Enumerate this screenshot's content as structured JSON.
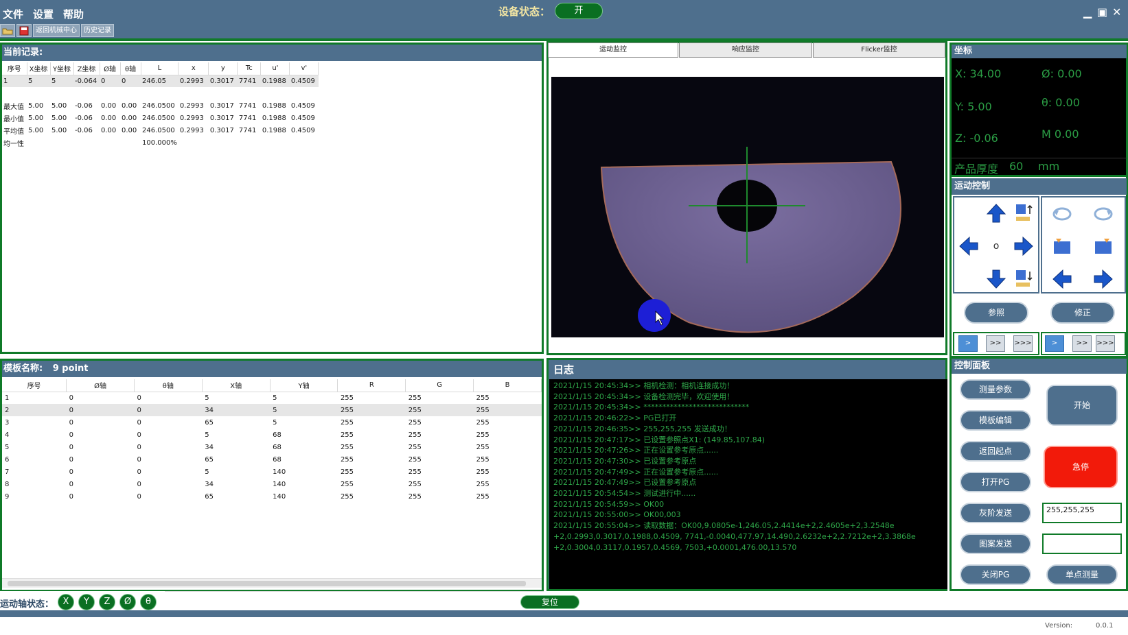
{
  "menu": [
    "文件",
    "设置",
    "帮助"
  ],
  "toolbar": {
    "return_center": "返回机械中心",
    "history": "历史记录"
  },
  "device_status": {
    "label": "设备状态：",
    "value": "开"
  },
  "current_record": {
    "title": "当前记录:",
    "columns": [
      "序号",
      "X坐标",
      "Y坐标",
      "Z坐标",
      "Ø轴",
      "θ轴",
      "L",
      "x",
      "y",
      "Tc",
      "u'",
      "v'"
    ],
    "rows": [
      [
        "1",
        "5",
        "5",
        "-0.064",
        "0",
        "0",
        "246.05",
        "0.2993",
        "0.3017",
        "7741",
        "0.1988",
        "0.4509"
      ],
      [
        "",
        "",
        "",
        "",
        "",
        "",
        "",
        "",
        "",
        "",
        "",
        ""
      ],
      [
        "最大值",
        "5.00",
        "5.00",
        "-0.06",
        "0.00",
        "0.00",
        "246.0500",
        "0.2993",
        "0.3017",
        "7741",
        "0.1988",
        "0.4509"
      ],
      [
        "最小值",
        "5.00",
        "5.00",
        "-0.06",
        "0.00",
        "0.00",
        "246.0500",
        "0.2993",
        "0.3017",
        "7741",
        "0.1988",
        "0.4509"
      ],
      [
        "平均值",
        "5.00",
        "5.00",
        "-0.06",
        "0.00",
        "0.00",
        "246.0500",
        "0.2993",
        "0.3017",
        "7741",
        "0.1988",
        "0.4509"
      ],
      [
        "均一性",
        "",
        "",
        "",
        "",
        "",
        "100.000%",
        "",
        "",
        "",
        "",
        ""
      ]
    ]
  },
  "tabs": [
    "运动监控",
    "响应监控",
    "Flicker监控"
  ],
  "template": {
    "label": "模板名称:",
    "name": "9 point",
    "columns": [
      "序号",
      "Ø轴",
      "θ轴",
      "X轴",
      "Y轴",
      "R",
      "G",
      "B"
    ],
    "rows": [
      [
        "1",
        "0",
        "0",
        "5",
        "5",
        "255",
        "255",
        "255"
      ],
      [
        "2",
        "0",
        "0",
        "34",
        "5",
        "255",
        "255",
        "255"
      ],
      [
        "3",
        "0",
        "0",
        "65",
        "5",
        "255",
        "255",
        "255"
      ],
      [
        "4",
        "0",
        "0",
        "5",
        "68",
        "255",
        "255",
        "255"
      ],
      [
        "5",
        "0",
        "0",
        "34",
        "68",
        "255",
        "255",
        "255"
      ],
      [
        "6",
        "0",
        "0",
        "65",
        "68",
        "255",
        "255",
        "255"
      ],
      [
        "7",
        "0",
        "0",
        "5",
        "140",
        "255",
        "255",
        "255"
      ],
      [
        "8",
        "0",
        "0",
        "34",
        "140",
        "255",
        "255",
        "255"
      ],
      [
        "9",
        "0",
        "0",
        "65",
        "140",
        "255",
        "255",
        "255"
      ]
    ]
  },
  "log": {
    "title": "日志",
    "lines": [
      "2021/1/15 20:45:34>> 相机检测：相机连接成功！",
      "2021/1/15 20:45:34>> 设备检测完毕，欢迎使用！",
      "2021/1/15 20:45:34>> ****************************",
      "2021/1/15 20:46:22>> PG已打开",
      "2021/1/15 20:46:35>> 255,255,255 发送成功！",
      "2021/1/15 20:47:17>> 已设置参照点X1: (149.85,107.84)",
      "2021/1/15 20:47:26>> 正在设置参考原点......",
      "2021/1/15 20:47:30>> 已设置参考原点",
      "2021/1/15 20:47:49>> 正在设置参考原点......",
      "2021/1/15 20:47:49>> 已设置参考原点",
      "2021/1/15 20:54:54>> 测试进行中......",
      "2021/1/15 20:54:59>> OK00",
      "2021/1/15 20:55:00>> OK00,003",
      "2021/1/15 20:55:04>> 读取数据：OK00,9.0805e-1,246.05,2.4414e+2,2.4605e+2,3.2548e",
      "+2,0.2993,0.3017,0.1988,0.4509, 7741,-0.0040,477.97,14.490,2.6232e+2,2.7212e+2,3.3868e",
      "+2,0.3004,0.3117,0.1957,0.4569, 7503,+0.0001,476.00,13.570"
    ]
  },
  "coords": {
    "title": "坐标",
    "x": "X: 34.00",
    "phi": "Ø: 0.00",
    "y": "Y: 5.00",
    "theta": "θ: 0.00",
    "z": "Z: -0.06",
    "m": "M  0.00",
    "thickness_label": "产品厚度",
    "thickness_value": "60",
    "thickness_unit": "mm"
  },
  "motion": {
    "title": "运动控制",
    "center": "o",
    "ref_button": "参照",
    "fix_button": "修正",
    "speed_left": [
      ">",
      ">>",
      ">>>"
    ],
    "speed_right": [
      ">",
      ">>",
      ">>>"
    ]
  },
  "control": {
    "title": "控制面板",
    "measure_params": "测量参数",
    "template_edit": "模板编辑",
    "return_origin": "返回起点",
    "open_pg": "打开PG",
    "gray_send": "灰阶发送",
    "pattern_send": "图案发送",
    "close_pg": "关闭PG",
    "start": "开始",
    "emergency": "急停",
    "single_measure": "单点测量",
    "gray_value": "255,255,255",
    "pattern_value": ""
  },
  "axis_status": {
    "label": "运动轴状态：",
    "axes": [
      "X",
      "Y",
      "Z",
      "Ø",
      "θ"
    ]
  },
  "reset_button": "复位",
  "version": {
    "label": "Version:",
    "value": "0.0.1"
  },
  "colors": {
    "accent": "#4e6f8d",
    "frame": "#0f7a28",
    "log_text": "#2fa84a",
    "emergency": "#f21a0a"
  }
}
